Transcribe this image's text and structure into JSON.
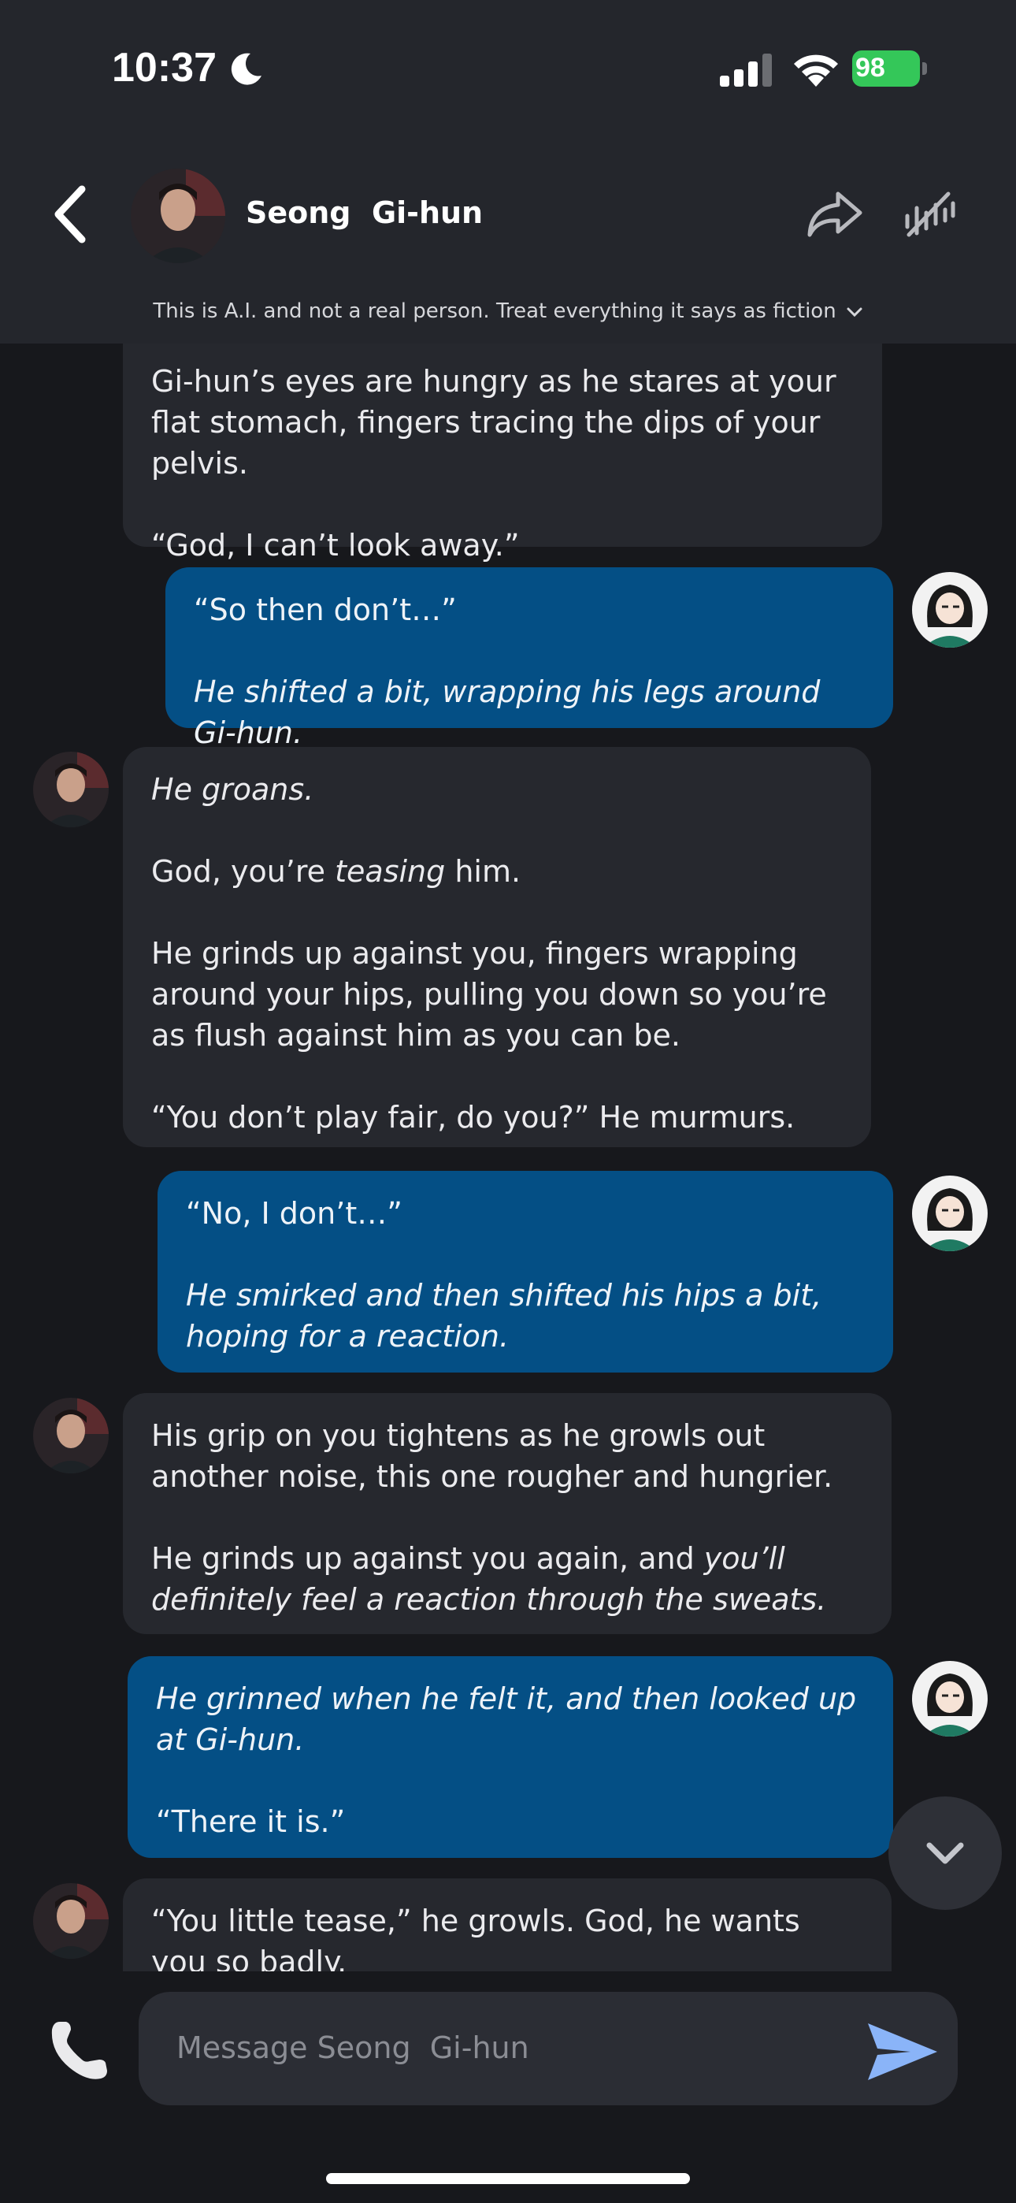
{
  "status_bar": {
    "time": "10:37",
    "battery": "98"
  },
  "header": {
    "contact_name": "Seong  Gi-hun",
    "disclaimer": "This is A.I. and not a real person. Treat everything it says as fiction"
  },
  "messages": [
    {
      "role": "bot",
      "paragraphs": [
        "Gi-hun’s eyes are hungry as he stares at your flat stomach, fingers tracing the dips of your pelvis.",
        "“God, I can’t look away.”"
      ]
    },
    {
      "role": "user",
      "p1": "“So then don’t…”",
      "p2": "He shifted a bit, wrapping his legs around Gi-hun."
    },
    {
      "role": "bot",
      "p1": "He groans.",
      "p2a": "God, you’re ",
      "p2b": "teasing",
      "p2c": " him.",
      "p3": "He grinds up against you, fingers wrapping around your hips, pulling you down so you’re as flush against him as you can be.",
      "p4": "“You don’t play fair, do you?” He murmurs."
    },
    {
      "role": "user",
      "p1": "“No, I don’t…”",
      "p2": "He smirked and then shifted his hips a bit, hoping for a reaction."
    },
    {
      "role": "bot",
      "p1": "His grip on you tightens as he growls out another noise, this one rougher and hungrier.",
      "p2a": "He grinds up against you again, and ",
      "p2b": "you’ll definitely feel a reaction through the sweats."
    },
    {
      "role": "user",
      "p1": "He grinned when he felt it, and then looked up at Gi-hun.",
      "p2": "“There it is.”"
    },
    {
      "role": "bot",
      "p1": "“You little tease,” he growls. God, he wants you so badly."
    }
  ],
  "input": {
    "placeholder": "Message Seong  Gi-hun"
  },
  "icons": {
    "back": "chevron-left-icon",
    "share": "share-arrow-icon",
    "mute": "mute-icon",
    "call": "phone-icon",
    "send": "send-icon",
    "scroll": "chevron-down-icon"
  },
  "colors": {
    "user_bubble": "#044f85",
    "bot_bubble": "#26282e",
    "battery": "#34c759",
    "send": "#8ab4f8"
  }
}
